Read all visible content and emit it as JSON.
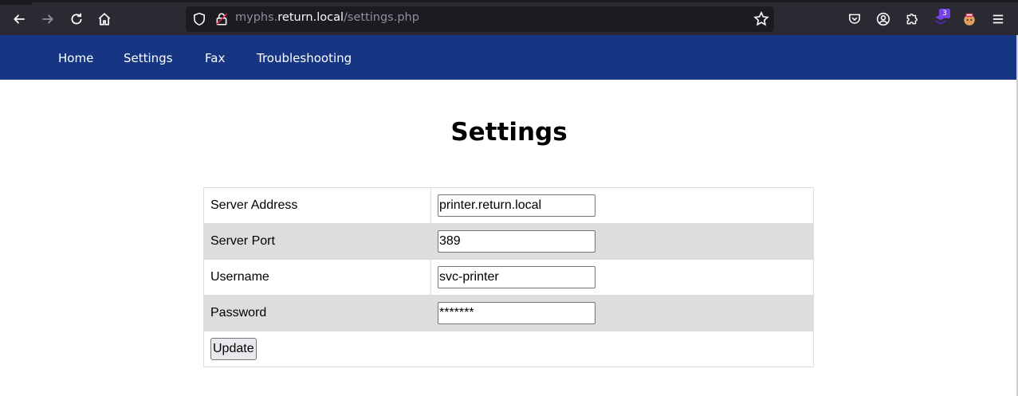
{
  "browser": {
    "url_prefix": "myphs.",
    "url_host": "return.local",
    "url_path": "/settings.php",
    "extension_badge": "3"
  },
  "nav": {
    "items": [
      {
        "label": "Home"
      },
      {
        "label": "Settings"
      },
      {
        "label": "Fax"
      },
      {
        "label": "Troubleshooting"
      }
    ]
  },
  "page": {
    "title": "Settings"
  },
  "form": {
    "rows": [
      {
        "label": "Server Address",
        "value": "printer.return.local"
      },
      {
        "label": "Server Port",
        "value": "389"
      },
      {
        "label": "Username",
        "value": "svc-printer"
      },
      {
        "label": "Password",
        "value": "*******"
      }
    ],
    "submit_label": "Update"
  }
}
